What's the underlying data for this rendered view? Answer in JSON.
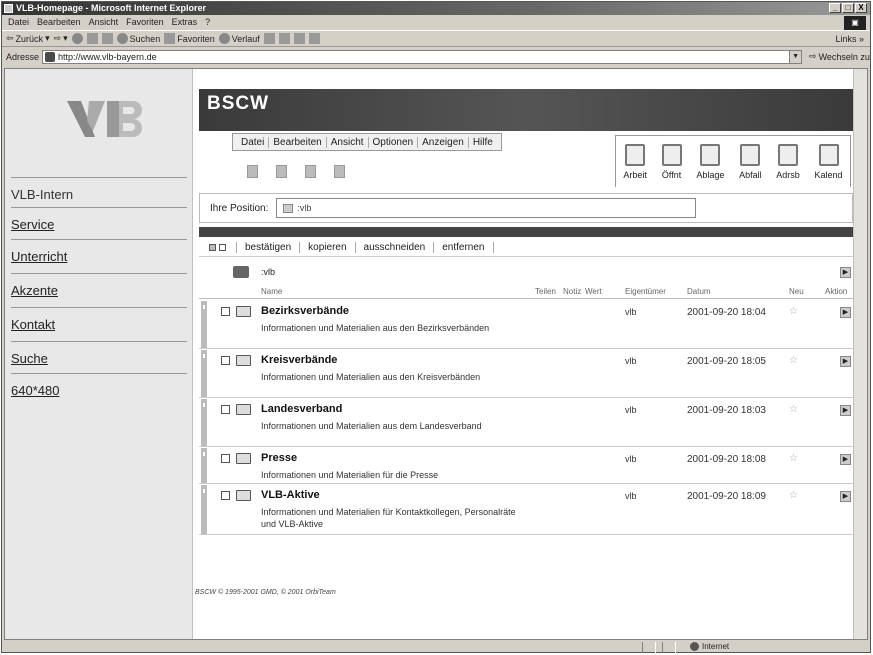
{
  "window": {
    "title": "VLB-Homepage - Microsoft Internet Explorer",
    "buttons": [
      "_",
      "□",
      "X"
    ]
  },
  "menubar": {
    "items": [
      "Datei",
      "Bearbeiten",
      "Ansicht",
      "Favoriten",
      "Extras",
      "?"
    ],
    "links_label": "Links »"
  },
  "toolbar": {
    "back": "Zurück",
    "search": "Suchen",
    "favorites": "Favoriten",
    "history": "Verlauf"
  },
  "addressbar": {
    "label": "Adresse",
    "url": "http://www.vlb-bayern.de",
    "go_label": "Wechseln zu"
  },
  "nav": {
    "logo_text": "VLB",
    "items": [
      "VLB-Intern",
      "Service",
      "Unterricht",
      "Akzente",
      "Kontakt",
      "Suche",
      "640*480"
    ]
  },
  "bscw": {
    "logo": "BSCW",
    "menu": [
      "Datei",
      "Bearbeiten",
      "Ansicht",
      "Optionen",
      "Anzeigen",
      "Hilfe"
    ],
    "big_tabs": [
      "Arbeit",
      "Öffnt",
      "Ablage",
      "Abfall",
      "Adrsb",
      "Kalend"
    ],
    "position_label": "Ihre Position:",
    "position_value": ":vlb",
    "actions": [
      "bestätigen",
      "kopieren",
      "ausschneiden",
      "entfernen"
    ],
    "folder_label": ":vlb",
    "columns": [
      "Name",
      "Teilen",
      "Notiz",
      "Wert",
      "Eigentümer",
      "Datum",
      "Neu",
      "Aktion"
    ],
    "rows": [
      {
        "name": "Bezirksverbände",
        "desc": "Informationen und Materialien aus den Bezirksverbänden",
        "owner": "vlb",
        "date": "2001-09-20 18:04",
        "new": "☆"
      },
      {
        "name": "Kreisverbände",
        "desc": "Informationen und Materialien aus den Kreisverbänden",
        "owner": "vlb",
        "date": "2001-09-20 18:05",
        "new": "☆"
      },
      {
        "name": "Landesverband",
        "desc": "Informationen und Materialien aus dem Landesverband",
        "owner": "vlb",
        "date": "2001-09-20 18:03",
        "new": "☆"
      },
      {
        "name": "Presse",
        "desc": "Informationen und Materialien für die Presse",
        "owner": "vlb",
        "date": "2001-09-20 18:08",
        "new": "☆"
      },
      {
        "name": "VLB-Aktive",
        "desc": "Informationen und Materialien für Kontaktkollegen, Personalräte und VLB-Aktive",
        "owner": "vlb",
        "date": "2001-09-20 18:09",
        "new": "☆"
      }
    ],
    "copyright": "BSCW © 1995-2001 GMD, © 2001 OrbiTeam"
  },
  "statusbar": {
    "left": "",
    "zone": "Internet"
  }
}
